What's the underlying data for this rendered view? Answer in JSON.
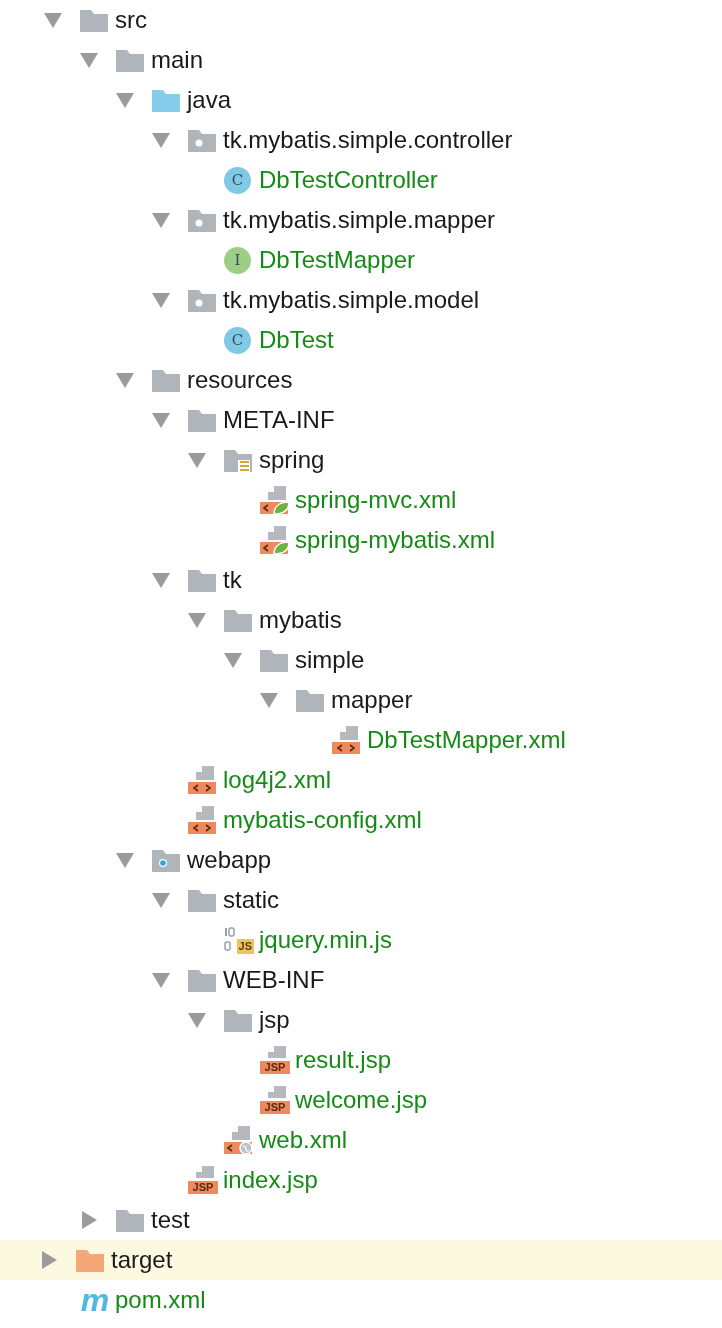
{
  "tree": [
    {
      "name": "src",
      "kind": "folder",
      "expanded": true,
      "selected": false,
      "children": [
        {
          "name": "main",
          "kind": "folder",
          "expanded": true,
          "selected": false,
          "children": [
            {
              "name": "java",
              "kind": "source_folder",
              "expanded": true,
              "selected": false,
              "children": [
                {
                  "name": "tk.mybatis.simple.controller",
                  "kind": "package",
                  "expanded": true,
                  "selected": false,
                  "children": [
                    {
                      "name": "DbTestController",
                      "kind": "class",
                      "icon_label": "C",
                      "selected": false
                    }
                  ]
                },
                {
                  "name": "tk.mybatis.simple.mapper",
                  "kind": "package",
                  "expanded": true,
                  "selected": false,
                  "children": [
                    {
                      "name": "DbTestMapper",
                      "kind": "interface",
                      "icon_label": "I",
                      "selected": false
                    }
                  ]
                },
                {
                  "name": "tk.mybatis.simple.model",
                  "kind": "package",
                  "expanded": true,
                  "selected": false,
                  "children": [
                    {
                      "name": "DbTest",
                      "kind": "class",
                      "icon_label": "C",
                      "selected": false
                    }
                  ]
                }
              ]
            },
            {
              "name": "resources",
              "kind": "folder",
              "expanded": true,
              "selected": false,
              "children": [
                {
                  "name": "META-INF",
                  "kind": "folder",
                  "expanded": true,
                  "selected": false,
                  "children": [
                    {
                      "name": "spring",
                      "kind": "config_folder",
                      "expanded": true,
                      "selected": false,
                      "children": [
                        {
                          "name": "spring-mvc.xml",
                          "kind": "spring_xml",
                          "selected": false
                        },
                        {
                          "name": "spring-mybatis.xml",
                          "kind": "spring_xml",
                          "selected": false
                        }
                      ]
                    }
                  ]
                },
                {
                  "name": "tk",
                  "kind": "folder",
                  "expanded": true,
                  "selected": false,
                  "children": [
                    {
                      "name": "mybatis",
                      "kind": "folder",
                      "expanded": true,
                      "selected": false,
                      "children": [
                        {
                          "name": "simple",
                          "kind": "folder",
                          "expanded": true,
                          "selected": false,
                          "children": [
                            {
                              "name": "mapper",
                              "kind": "folder",
                              "expanded": true,
                              "selected": false,
                              "children": [
                                {
                                  "name": "DbTestMapper.xml",
                                  "kind": "xml",
                                  "selected": false
                                }
                              ]
                            }
                          ]
                        }
                      ]
                    }
                  ]
                },
                {
                  "name": "log4j2.xml",
                  "kind": "xml",
                  "selected": false
                },
                {
                  "name": "mybatis-config.xml",
                  "kind": "xml",
                  "selected": false
                }
              ]
            },
            {
              "name": "webapp",
              "kind": "web_folder",
              "expanded": true,
              "selected": false,
              "children": [
                {
                  "name": "static",
                  "kind": "folder",
                  "expanded": true,
                  "selected": false,
                  "children": [
                    {
                      "name": "jquery.min.js",
                      "kind": "js",
                      "icon_label": "JS",
                      "selected": false
                    }
                  ]
                },
                {
                  "name": "WEB-INF",
                  "kind": "folder",
                  "expanded": true,
                  "selected": false,
                  "children": [
                    {
                      "name": "jsp",
                      "kind": "folder",
                      "expanded": true,
                      "selected": false,
                      "children": [
                        {
                          "name": "result.jsp",
                          "kind": "jsp",
                          "icon_label": "JSP",
                          "selected": false
                        },
                        {
                          "name": "welcome.jsp",
                          "kind": "jsp",
                          "icon_label": "JSP",
                          "selected": false
                        }
                      ]
                    },
                    {
                      "name": "web.xml",
                      "kind": "web_xml",
                      "selected": false
                    }
                  ]
                },
                {
                  "name": "index.jsp",
                  "kind": "jsp",
                  "icon_label": "JSP",
                  "selected": false
                }
              ]
            }
          ]
        },
        {
          "name": "test",
          "kind": "folder",
          "expanded": false,
          "selected": false
        }
      ]
    },
    {
      "name": "target",
      "kind": "excluded_folder",
      "expanded": false,
      "selected": true
    },
    {
      "name": "pom.xml",
      "kind": "maven",
      "icon_label": "m",
      "selected": false
    }
  ]
}
